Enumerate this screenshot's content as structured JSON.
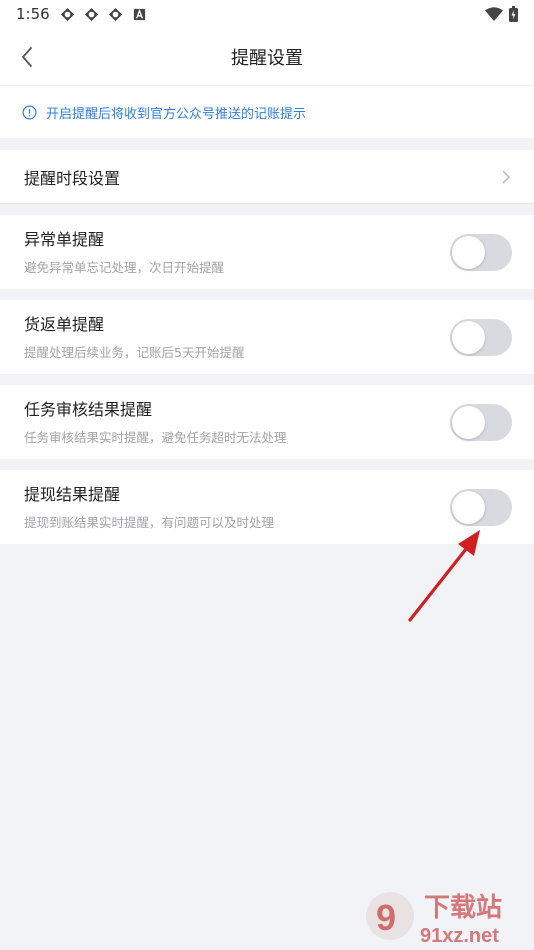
{
  "status_bar": {
    "time": "1:56",
    "icons": [
      "app-icon",
      "app-icon",
      "app-icon",
      "a-icon"
    ],
    "right_icons": [
      "wifi-icon",
      "battery-icon"
    ]
  },
  "nav": {
    "title": "提醒设置"
  },
  "notice": {
    "text": "开启提醒后将收到官方公众号推送的记账提示"
  },
  "period_row": {
    "label": "提醒时段设置"
  },
  "items": [
    {
      "title": "异常单提醒",
      "desc": "避免异常单忘记处理，次日开始提醒",
      "enabled": false
    },
    {
      "title": "货返单提醒",
      "desc": "提醒处理后续业务，记账后5天开始提醒",
      "enabled": false
    },
    {
      "title": "任务审核结果提醒",
      "desc": "任务审核结果实时提醒，避免任务超时无法处理",
      "enabled": false
    },
    {
      "title": "提现结果提醒",
      "desc": "提现到账结果实时提醒，有问题可以及时处理",
      "enabled": false
    }
  ],
  "watermark": {
    "line1": "下载站",
    "line2": "91xz.net"
  },
  "colors": {
    "accent": "#2f7fe6",
    "toggle_off": "#d9dae0",
    "annotation": "#d0201f"
  }
}
